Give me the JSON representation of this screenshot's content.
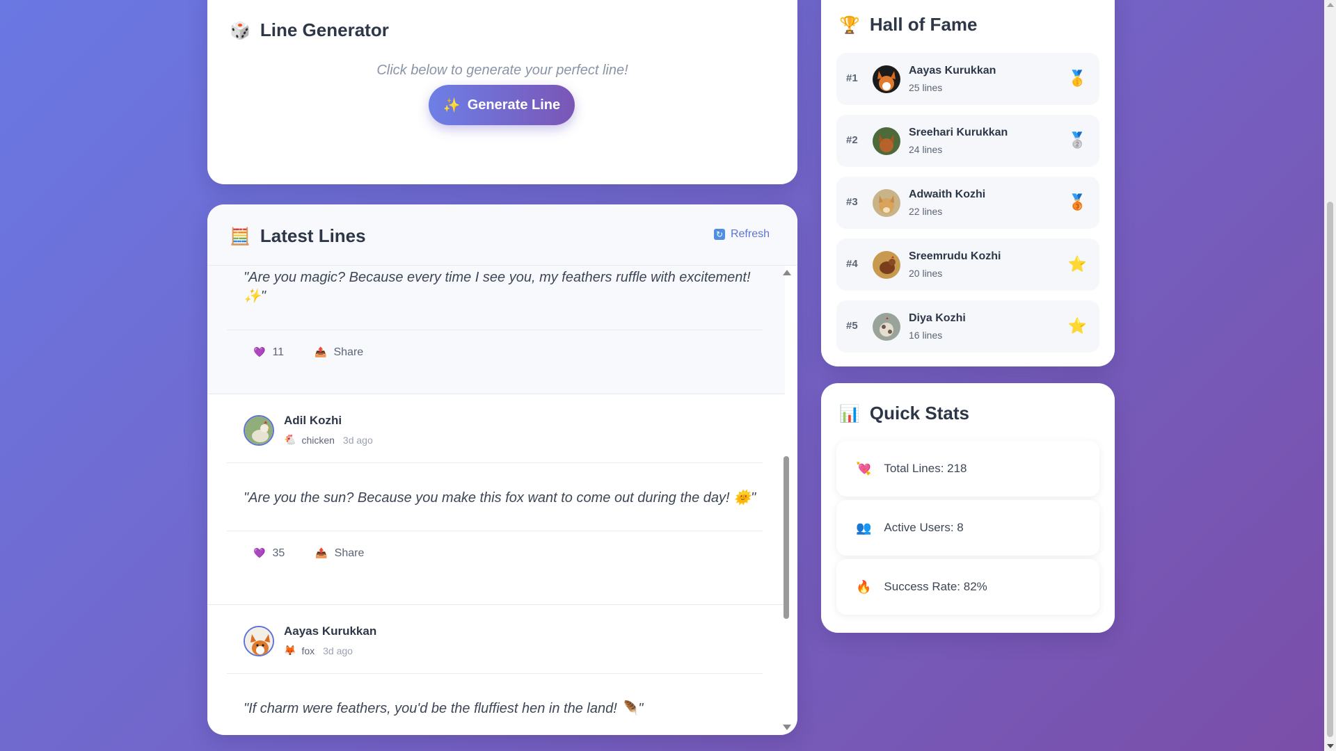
{
  "generator": {
    "icon": "dice-icon",
    "icon_glyph": "🎲",
    "title": "Line Generator",
    "prompt": "Click below to generate your perfect line!",
    "button_glyph": "✨",
    "button_label": "Generate Line"
  },
  "latest": {
    "icon": "abacus-icon",
    "icon_glyph": "🧮",
    "title": "Latest Lines",
    "refresh_glyph": "🔄",
    "refresh_label": "Refresh",
    "posts": [
      {
        "text": "\"Are you magic? Because every time I see you, my feathers ruffle with excitement! ✨\"",
        "likes": "11",
        "like_glyph": "💜",
        "share_glyph": "📤",
        "share_label": "Share"
      },
      {
        "author": "Adil Kozhi",
        "animal_glyph": "🐔",
        "animal": "chicken",
        "ago": "3d ago",
        "text": "\"Are you the sun? Because you make this fox want to come out during the day! 🌞\"",
        "likes": "35",
        "like_glyph": "💜",
        "share_glyph": "📤",
        "share_label": "Share"
      },
      {
        "author": "Aayas Kurukkan",
        "animal_glyph": "🦊",
        "animal": "fox",
        "ago": "3d ago",
        "text": "\"If charm were feathers, you'd be the fluffiest hen in the land! 🪶\""
      }
    ]
  },
  "hall_of_fame": {
    "icon": "trophy-icon",
    "icon_glyph": "🏆",
    "title": "Hall of Fame",
    "entries": [
      {
        "rank": "#1",
        "name": "Aayas Kurukkan",
        "count": "25 lines",
        "badge": "gold-medal-icon",
        "badge_glyph": "🥇"
      },
      {
        "rank": "#2",
        "name": "Sreehari Kurukkan",
        "count": "24 lines",
        "badge": "silver-medal-icon",
        "badge_glyph": "🥈"
      },
      {
        "rank": "#3",
        "name": "Adwaith Kozhi",
        "count": "22 lines",
        "badge": "bronze-medal-icon",
        "badge_glyph": "🥉"
      },
      {
        "rank": "#4",
        "name": "Sreemrudu Kozhi",
        "count": "20 lines",
        "badge": "star-icon",
        "badge_glyph": "⭐"
      },
      {
        "rank": "#5",
        "name": "Diya Kozhi",
        "count": "16 lines",
        "badge": "star-icon",
        "badge_glyph": "⭐"
      }
    ]
  },
  "quick_stats": {
    "icon": "bar-chart-icon",
    "icon_glyph": "📊",
    "title": "Quick Stats",
    "items": [
      {
        "icon": "heart-arrow-icon",
        "glyph": "💘",
        "label": "Total Lines: 218"
      },
      {
        "icon": "users-icon",
        "glyph": "👥",
        "label": "Active Users: 8"
      },
      {
        "icon": "fire-icon",
        "glyph": "🔥",
        "label": "Success Rate: 82%"
      }
    ]
  },
  "colors": {
    "background_start": "#6a78e3",
    "background_end": "#7a4ea8",
    "accent": "#6d7fe6",
    "link": "#5a74d8"
  }
}
